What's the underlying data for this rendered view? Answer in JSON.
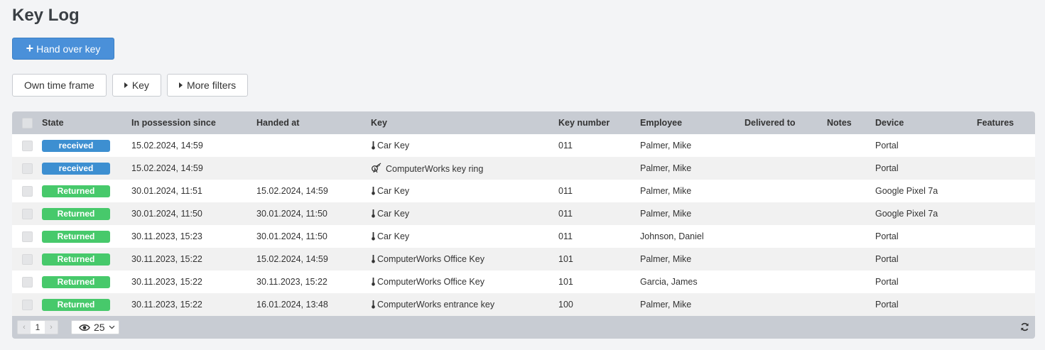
{
  "page": {
    "title": "Key Log"
  },
  "actions": {
    "hand_over_label": "Hand over key"
  },
  "filters": [
    {
      "label": "Own time frame",
      "caret": false
    },
    {
      "label": "Key",
      "caret": true
    },
    {
      "label": "More filters",
      "caret": true
    }
  ],
  "table": {
    "columns": [
      "State",
      "In possession since",
      "Handed at",
      "Key",
      "Key number",
      "Employee",
      "Delivered to",
      "Notes",
      "Device",
      "Features"
    ],
    "rows": [
      {
        "state": "received",
        "since": "15.02.2024, 14:59",
        "handed": "",
        "key": "Car Key",
        "key_icon": "key-icon",
        "key_number": "011",
        "employee": "Palmer, Mike",
        "delivered_to": "",
        "notes": "",
        "device": "Portal",
        "features": ""
      },
      {
        "state": "received",
        "since": "15.02.2024, 14:59",
        "handed": "",
        "key": "ComputerWorks key ring",
        "key_icon": "key-ring-icon",
        "key_number": "",
        "employee": "Palmer, Mike",
        "delivered_to": "",
        "notes": "",
        "device": "Portal",
        "features": ""
      },
      {
        "state": "Returned",
        "since": "30.01.2024, 11:51",
        "handed": "15.02.2024, 14:59",
        "key": "Car Key",
        "key_icon": "key-icon",
        "key_number": "011",
        "employee": "Palmer, Mike",
        "delivered_to": "",
        "notes": "",
        "device": "Google Pixel 7a",
        "features": ""
      },
      {
        "state": "Returned",
        "since": "30.01.2024, 11:50",
        "handed": "30.01.2024, 11:50",
        "key": "Car Key",
        "key_icon": "key-icon",
        "key_number": "011",
        "employee": "Palmer, Mike",
        "delivered_to": "",
        "notes": "",
        "device": "Google Pixel 7a",
        "features": ""
      },
      {
        "state": "Returned",
        "since": "30.11.2023, 15:23",
        "handed": "30.01.2024, 11:50",
        "key": "Car Key",
        "key_icon": "key-icon",
        "key_number": "011",
        "employee": "Johnson, Daniel",
        "delivered_to": "",
        "notes": "",
        "device": "Portal",
        "features": ""
      },
      {
        "state": "Returned",
        "since": "30.11.2023, 15:22",
        "handed": "15.02.2024, 14:59",
        "key": "ComputerWorks Office Key",
        "key_icon": "key-icon",
        "key_number": "101",
        "employee": "Palmer, Mike",
        "delivered_to": "",
        "notes": "",
        "device": "Portal",
        "features": ""
      },
      {
        "state": "Returned",
        "since": "30.11.2023, 15:22",
        "handed": "30.11.2023, 15:22",
        "key": "ComputerWorks Office Key",
        "key_icon": "key-icon",
        "key_number": "101",
        "employee": "Garcia, James",
        "delivered_to": "",
        "notes": "",
        "device": "Portal",
        "features": ""
      },
      {
        "state": "Returned",
        "since": "30.11.2023, 15:22",
        "handed": "16.01.2024, 13:48",
        "key": "ComputerWorks entrance key",
        "key_icon": "key-icon",
        "key_number": "100",
        "employee": "Palmer, Mike",
        "delivered_to": "",
        "notes": "",
        "device": "Portal",
        "features": ""
      }
    ]
  },
  "pagination": {
    "prev": "‹",
    "current_page": "1",
    "next": "›",
    "page_size": "25"
  },
  "colors": {
    "primary": "#4a90d9",
    "received": "#3d8fd1",
    "returned": "#47c96b",
    "header_bg": "#c8ccd3"
  }
}
